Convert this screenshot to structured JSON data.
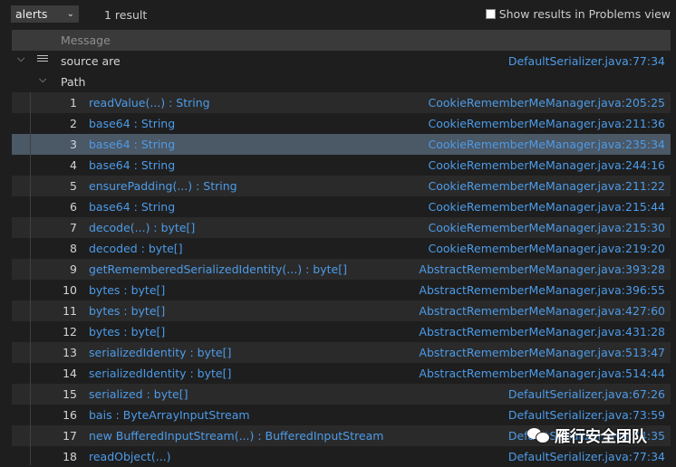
{
  "toolbar": {
    "select_value": "alerts",
    "result_count": "1 result",
    "problems_label": "Show results in Problems view"
  },
  "table": {
    "header": "Message",
    "alert": {
      "label": "source are",
      "location": "DefaultSerializer.java:77:34"
    },
    "path_label": "Path",
    "steps": [
      {
        "n": "1",
        "text": "readValue(...) : String",
        "loc": "CookieRememberMeManager.java:205:25"
      },
      {
        "n": "2",
        "text": "base64 : String",
        "loc": "CookieRememberMeManager.java:211:36"
      },
      {
        "n": "3",
        "text": "base64 : String",
        "loc": "CookieRememberMeManager.java:235:34"
      },
      {
        "n": "4",
        "text": "base64 : String",
        "loc": "CookieRememberMeManager.java:244:16"
      },
      {
        "n": "5",
        "text": "ensurePadding(...) : String",
        "loc": "CookieRememberMeManager.java:211:22"
      },
      {
        "n": "6",
        "text": "base64 : String",
        "loc": "CookieRememberMeManager.java:215:44"
      },
      {
        "n": "7",
        "text": "decode(...) : byte[]",
        "loc": "CookieRememberMeManager.java:215:30"
      },
      {
        "n": "8",
        "text": "decoded : byte[]",
        "loc": "CookieRememberMeManager.java:219:20"
      },
      {
        "n": "9",
        "text": "getRememberedSerializedIdentity(...) : byte[]",
        "loc": "AbstractRememberMeManager.java:393:28"
      },
      {
        "n": "10",
        "text": "bytes : byte[]",
        "loc": "AbstractRememberMeManager.java:396:55"
      },
      {
        "n": "11",
        "text": "bytes : byte[]",
        "loc": "AbstractRememberMeManager.java:427:60"
      },
      {
        "n": "12",
        "text": "bytes : byte[]",
        "loc": "AbstractRememberMeManager.java:431:28"
      },
      {
        "n": "13",
        "text": "serializedIdentity : byte[]",
        "loc": "AbstractRememberMeManager.java:513:47"
      },
      {
        "n": "14",
        "text": "serializedIdentity : byte[]",
        "loc": "AbstractRememberMeManager.java:514:44"
      },
      {
        "n": "15",
        "text": "serialized : byte[]",
        "loc": "DefaultSerializer.java:67:26"
      },
      {
        "n": "16",
        "text": "bais : ByteArrayInputStream",
        "loc": "DefaultSerializer.java:73:59"
      },
      {
        "n": "17",
        "text": "new BufferedInputStream(...) : BufferedInputStream",
        "loc": "DefaultSerializer.java:74:35"
      },
      {
        "n": "18",
        "text": "readObject(...)",
        "loc": "DefaultSerializer.java:77:34"
      }
    ]
  },
  "watermark": {
    "text": "雁行安全团队"
  },
  "colors": {
    "link": "#4d9be8",
    "selected_row": "#4b5866",
    "background": "#1e1e1e"
  },
  "icons": [
    "chevron-down-icon",
    "list-icon",
    "checkbox-icon",
    "wechat-logo-icon"
  ]
}
